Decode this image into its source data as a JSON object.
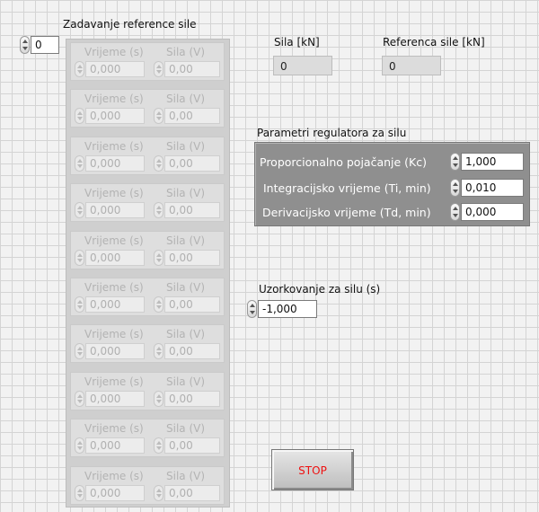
{
  "index_control": {
    "value": "0"
  },
  "array": {
    "title": "Zadavanje reference sile",
    "col_time": "Vrijeme (s)",
    "col_force": "Sila (V)",
    "rows": [
      {
        "time": "0,000",
        "force": "0,00"
      },
      {
        "time": "0,000",
        "force": "0,00"
      },
      {
        "time": "0,000",
        "force": "0,00"
      },
      {
        "time": "0,000",
        "force": "0,00"
      },
      {
        "time": "0,000",
        "force": "0,00"
      },
      {
        "time": "0,000",
        "force": "0,00"
      },
      {
        "time": "0,000",
        "force": "0,00"
      },
      {
        "time": "0,000",
        "force": "0,00"
      },
      {
        "time": "0,000",
        "force": "0,00"
      },
      {
        "time": "0,000",
        "force": "0,00"
      }
    ]
  },
  "sila": {
    "label": "Sila [kN]",
    "value": "0"
  },
  "referenca": {
    "label": "Referenca sile [kN]",
    "value": "0"
  },
  "params": {
    "title": "Parametri regulatora za silu",
    "kc_label": "Proporcionalno pojačanje (Kc)",
    "kc_value": "1,000",
    "ti_label": "Integracijsko vrijeme (Ti, min)",
    "ti_value": "0,010",
    "td_label": "Derivacijsko vrijeme (Td, min)",
    "td_value": "0,000"
  },
  "sampling": {
    "label": "Uzorkovanje za silu (s)",
    "value": "-1,000"
  },
  "stop": {
    "label": "STOP",
    "text_color": "#ee1111"
  }
}
